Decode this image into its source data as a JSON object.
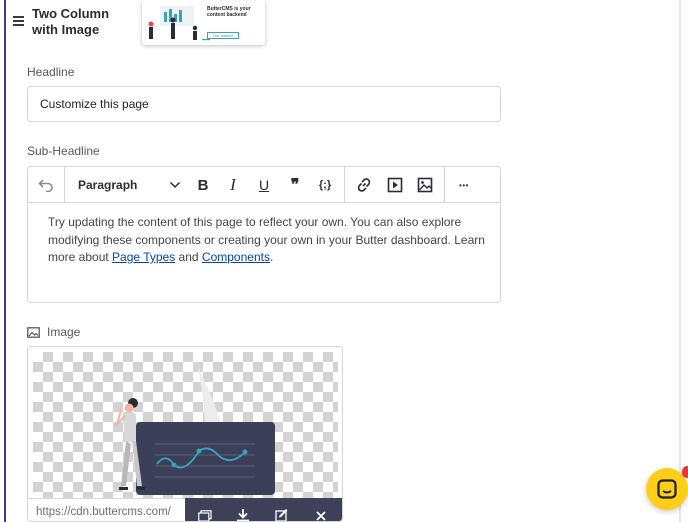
{
  "component": {
    "title_line1": "Two Column",
    "title_line2": "with Image",
    "thumbnail": {
      "heading": "ButterCMS is your content backend",
      "button": "Get started"
    }
  },
  "headline": {
    "label": "Headline",
    "value": "Customize this page"
  },
  "subheadline": {
    "label": "Sub-Headline",
    "toolbar": {
      "block_format": "Paragraph",
      "bold": "B",
      "italic": "I",
      "underline": "U",
      "quote": "❞",
      "code": "{;}",
      "more": "•••"
    },
    "content": {
      "text_before": "Try updating the content of this page to reflect your own. You can also explore modifying these components or creating your own in your Butter dashboard. Learn more about ",
      "link1": "Page Types",
      "text_middle": " and ",
      "link2": "Components",
      "text_after": "."
    }
  },
  "image": {
    "label": "Image",
    "url": "https://cdn.buttercms.com/"
  },
  "colors": {
    "accent": "#3c3f8f",
    "chat_button": "#ffcf17",
    "image_bar": "#3e4158",
    "chart_line": "#3aa3b8"
  }
}
